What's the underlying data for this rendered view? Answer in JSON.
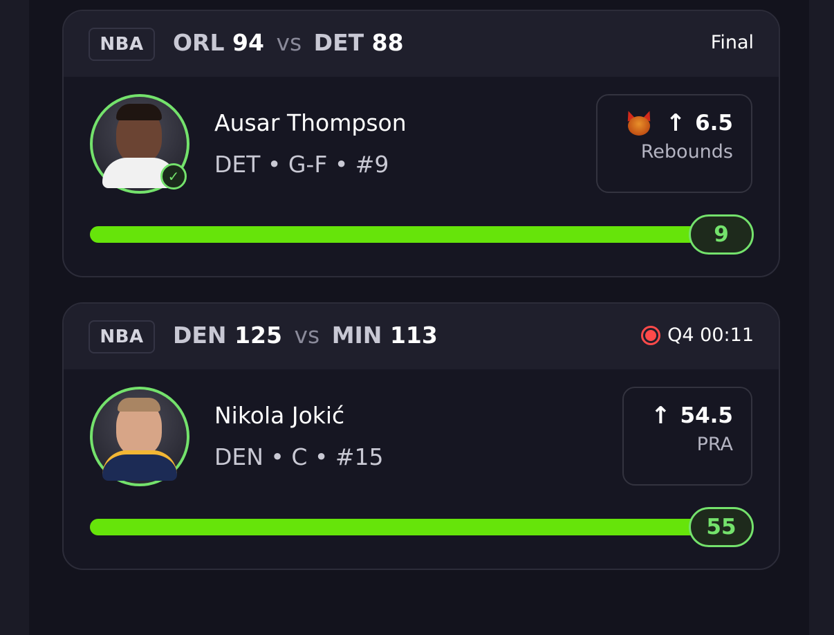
{
  "games": [
    {
      "league": "NBA",
      "away_team": "ORL",
      "away_score": "94",
      "vs": "vs",
      "home_team": "DET",
      "home_score": "88",
      "status": "Final",
      "player": {
        "name": "Ausar Thompson",
        "meta": "DET • G-F • #9",
        "picked": true
      },
      "prop": {
        "direction": "↑",
        "line": "6.5",
        "stat": "Rebounds",
        "boost_icon": "devil-icon"
      },
      "progress": {
        "current": "9",
        "fraction": 1.0
      }
    },
    {
      "league": "NBA",
      "away_team": "DEN",
      "away_score": "125",
      "vs": "vs",
      "home_team": "MIN",
      "home_score": "113",
      "status": "Q4 00:11",
      "live": true,
      "player": {
        "name": "Nikola Jokić",
        "meta": "DEN • C • #15"
      },
      "prop": {
        "direction": "↑",
        "line": "54.5",
        "stat": "PRA"
      },
      "progress": {
        "current": "55",
        "fraction": 1.0
      }
    }
  ],
  "colors": {
    "accent_green": "#74e26c",
    "progress_green": "#66e40a",
    "live_red": "#ff4a4a",
    "background": "#13131d"
  }
}
